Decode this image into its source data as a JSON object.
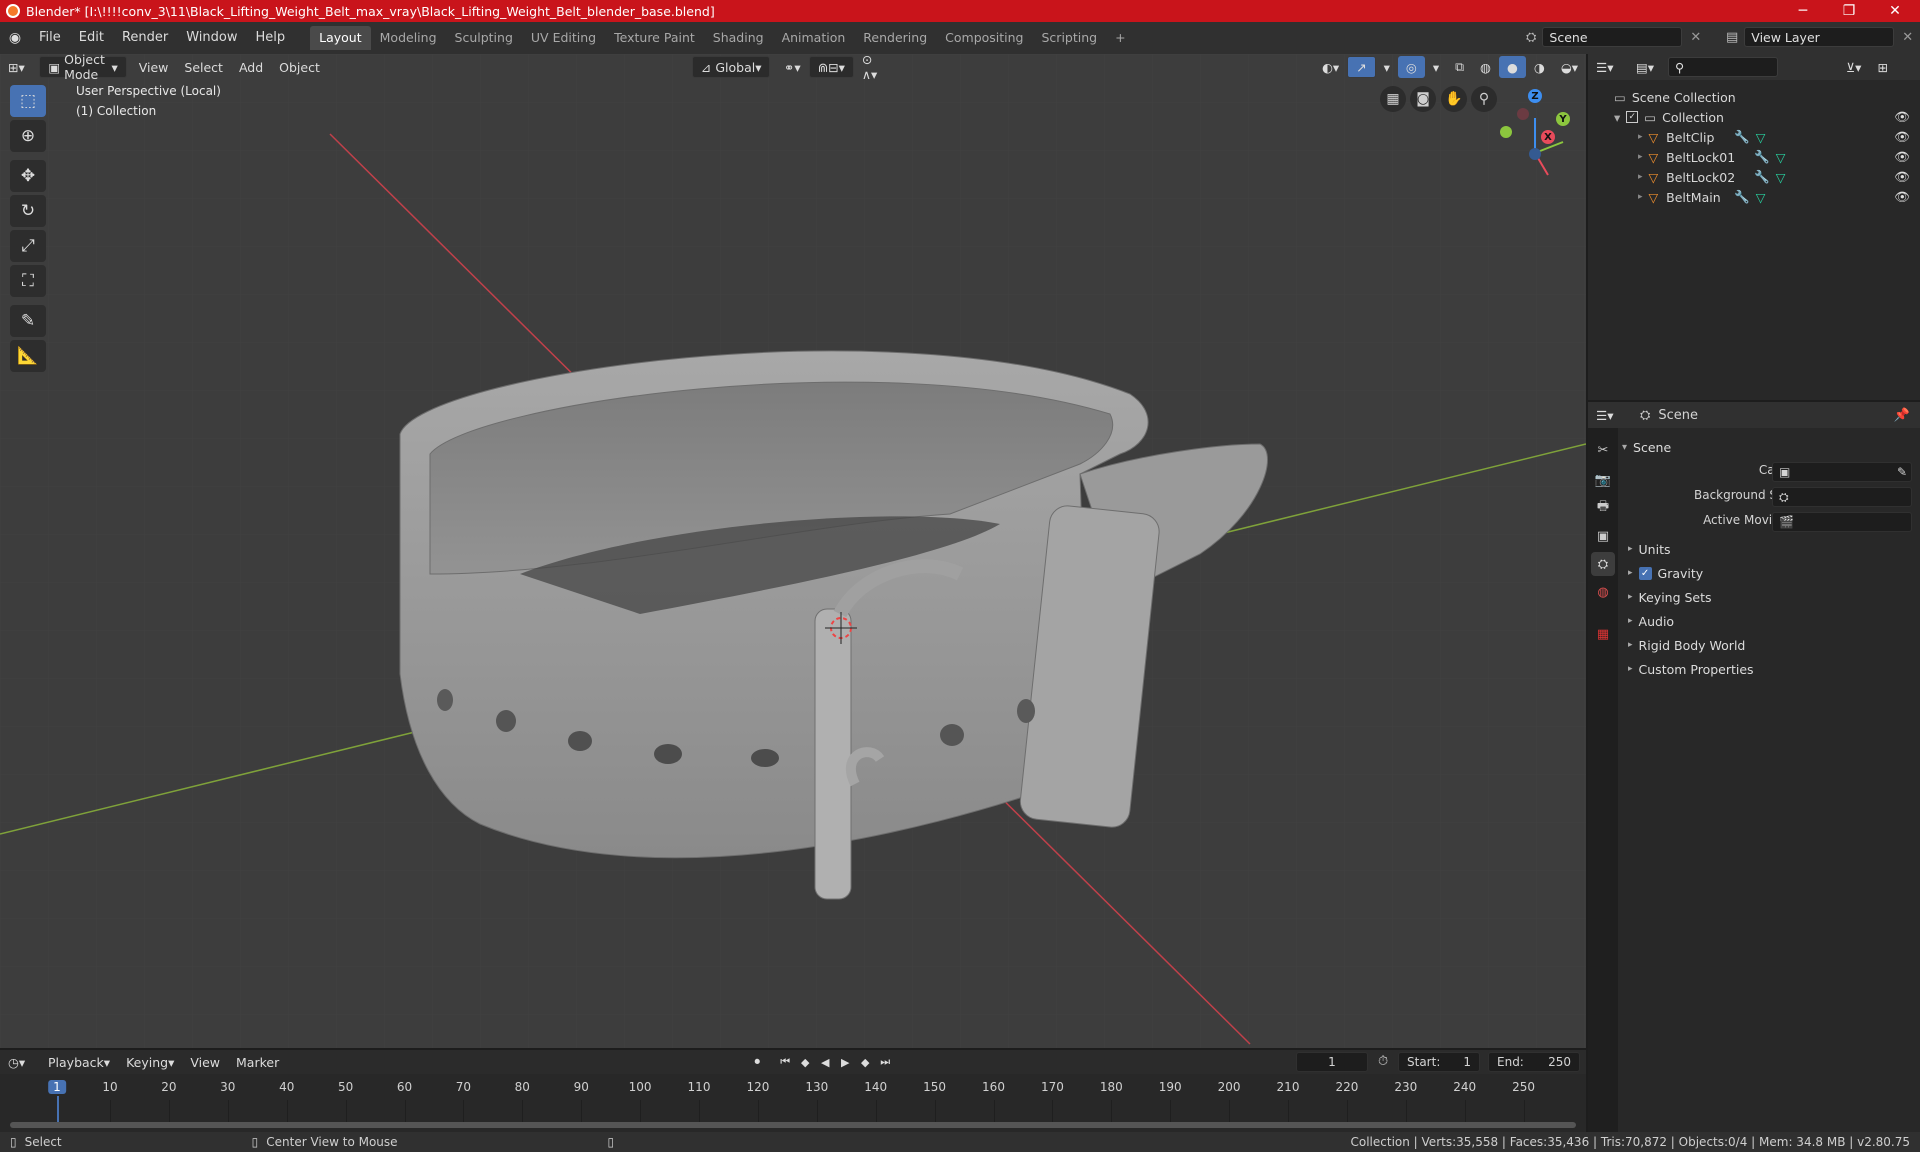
{
  "window": {
    "title": "Blender* [I:\\!!!!conv_3\\11\\Black_Lifting_Weight_Belt_max_vray\\Black_Lifting_Weight_Belt_blender_base.blend]",
    "minimize": "─",
    "maximize": "❐",
    "close": "✕"
  },
  "menubar": {
    "menus": [
      "File",
      "Edit",
      "Render",
      "Window",
      "Help"
    ],
    "workspaces": [
      "Layout",
      "Modeling",
      "Sculpting",
      "UV Editing",
      "Texture Paint",
      "Shading",
      "Animation",
      "Rendering",
      "Compositing",
      "Scripting"
    ],
    "active_workspace": "Layout",
    "add_tab": "+",
    "scene_name": "Scene",
    "view_layer_name": "View Layer"
  },
  "viewport_header": {
    "mode": "Object Mode",
    "menus": [
      "View",
      "Select",
      "Add",
      "Object"
    ],
    "orientation": "Global"
  },
  "viewport": {
    "perspective_label": "User Perspective (Local)",
    "collection_label": "(1) Collection",
    "gizmo_axes": {
      "z": "Z",
      "y": "Y",
      "x": "X"
    },
    "colors": {
      "x_axis": "#e84b5b",
      "y_axis": "#8cc63e",
      "z_axis": "#3d8ef0"
    }
  },
  "toolbar": {
    "tools": [
      "select-box",
      "cursor",
      "move",
      "rotate",
      "scale",
      "transform",
      "annotate",
      "measure"
    ]
  },
  "outliner": {
    "search_placeholder": "",
    "root": "Scene Collection",
    "collection": "Collection",
    "objects": [
      "BeltClip",
      "BeltLock01",
      "BeltLock02",
      "BeltMain"
    ]
  },
  "properties": {
    "context": "Scene",
    "panel": "Scene",
    "fields": [
      {
        "label": "Camera",
        "value": ""
      },
      {
        "label": "Background Scene",
        "value": ""
      },
      {
        "label": "Active Movie Clip",
        "value": ""
      }
    ],
    "sections": [
      "Units",
      "Gravity",
      "Keying Sets",
      "Audio",
      "Rigid Body World",
      "Custom Properties"
    ],
    "gravity_checked": true
  },
  "timeline": {
    "menus": [
      "Playback",
      "Keying",
      "View",
      "Marker"
    ],
    "current_frame": "1",
    "start_label": "Start:",
    "start": "1",
    "end_label": "End:",
    "end": "250",
    "ticks": [
      "1",
      "10",
      "20",
      "30",
      "40",
      "50",
      "60",
      "70",
      "80",
      "90",
      "100",
      "110",
      "120",
      "130",
      "140",
      "150",
      "160",
      "170",
      "180",
      "190",
      "200",
      "210",
      "220",
      "230",
      "240",
      "250"
    ]
  },
  "statusbar": {
    "left_action": "Select",
    "middle_action": "Center View to Mouse",
    "stats": "Collection | Verts:35,558 | Faces:35,436 | Tris:70,872 | Objects:0/4 | Mem: 34.8 MB | v2.80.75"
  },
  "accent": "#4772b3"
}
